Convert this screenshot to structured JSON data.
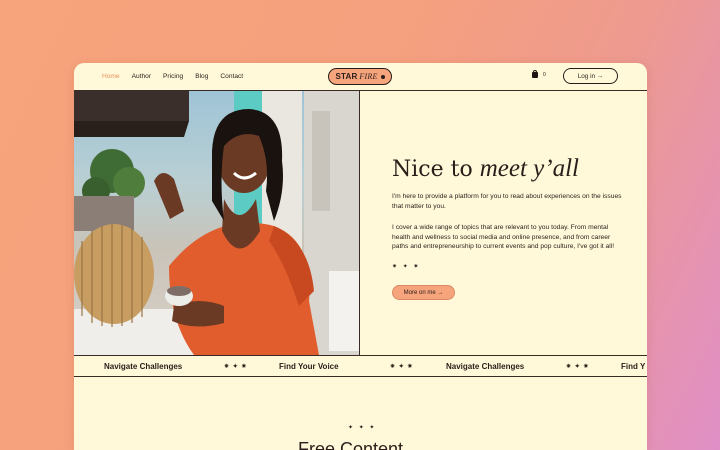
{
  "nav": {
    "links": [
      "Home",
      "Author",
      "Pricing",
      "Blog",
      "Contact"
    ],
    "active": "Home",
    "logo_part1": "STAR",
    "logo_part2": "FIRE",
    "cart_count": "0",
    "login_label": "Log in →"
  },
  "hero": {
    "headline_plain": "Nice to ",
    "headline_italic": "meet y’all",
    "para1": "I'm here to provide a platform for you to read about experiences on the issues that matter to you.",
    "para2": "I cover a wide range of topics that are relevant to you today. From mental health and wellness to social media and online presence, and from career paths and entrepreneurship to current events and pop culture, I've got it all!",
    "stars": "✷ ✦ ✷",
    "button_label": "More on me →"
  },
  "ticker": {
    "items": [
      "Navigate Challenges",
      "Find Your Voice",
      "Navigate Challenges",
      "Find Y"
    ],
    "separator": "✷ ✦ ✷"
  },
  "lower": {
    "stars": "✦ ✦ ✦",
    "title": "Free Content"
  },
  "colors": {
    "accent": "#f6a47c",
    "page_bg": "#fff9d9",
    "text": "#2b1d1a",
    "active_link": "#e8915f"
  }
}
